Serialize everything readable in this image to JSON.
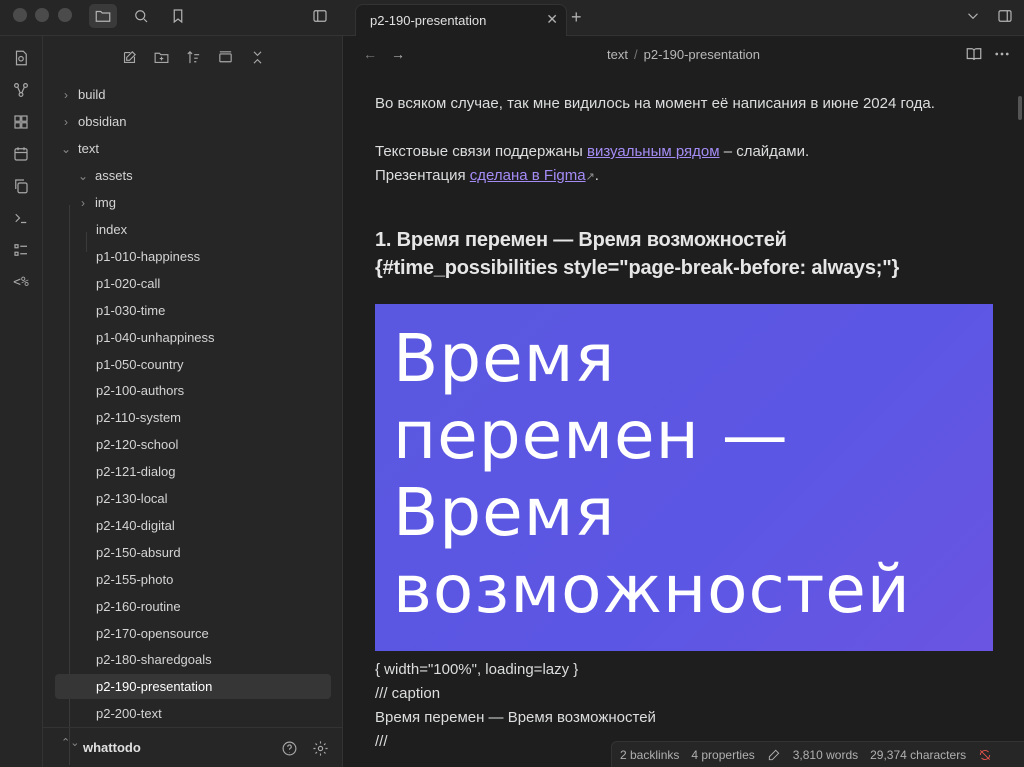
{
  "window": {
    "tab_title": "p2-190-presentation",
    "tab_close": "✕",
    "new_tab": "+"
  },
  "ribbon": {
    "templates_label": "<%"
  },
  "navbar": {
    "back": "←",
    "forward": "→",
    "crumb_folder": "text",
    "crumb_sep": "/",
    "crumb_file": "p2-190-presentation"
  },
  "file_tree": {
    "items": [
      {
        "label": "build",
        "chev": "›"
      },
      {
        "label": "obsidian",
        "chev": "›"
      },
      {
        "label": "text",
        "chev": "⌄"
      },
      {
        "label": "assets",
        "chev": "⌄"
      },
      {
        "label": "img",
        "chev": "›"
      },
      {
        "label": "index"
      },
      {
        "label": "p1-010-happiness"
      },
      {
        "label": "p1-020-call"
      },
      {
        "label": "p1-030-time"
      },
      {
        "label": "p1-040-unhappiness"
      },
      {
        "label": "p1-050-country"
      },
      {
        "label": "p2-100-authors"
      },
      {
        "label": "p2-110-system"
      },
      {
        "label": "p2-120-school"
      },
      {
        "label": "p2-121-dialog"
      },
      {
        "label": "p2-130-local"
      },
      {
        "label": "p2-140-digital"
      },
      {
        "label": "p2-150-absurd"
      },
      {
        "label": "p2-155-photo"
      },
      {
        "label": "p2-160-routine"
      },
      {
        "label": "p2-170-opensource"
      },
      {
        "label": "p2-180-sharedgoals"
      },
      {
        "label": "p2-190-presentation"
      },
      {
        "label": "p2-200-text"
      }
    ]
  },
  "sidebar_footer": {
    "vault_name": "whattodo",
    "switch_icon": "⌃⌄"
  },
  "document": {
    "line1": "Во всяком случае, так мне видилось на момент её написания в июне 2024 года.",
    "line2_before": "Текстовые связи поддержаны ",
    "line2_link": "визуальным рядом",
    "line2_after": " – слайдами.",
    "line3_before": "Презентация ",
    "line3_link": "сделана в Figma",
    "line3_ext": "↗",
    "line3_after": ".",
    "heading_line1": "1. Время перемен — Время возможностей",
    "heading_line2": "{#time_possibilities style=\"page-break-before: always;\"}",
    "slide_line1": "Время",
    "slide_line2": "перемен —",
    "slide_line3": "Время",
    "slide_line4": "возможностей",
    "attr_line": "{ width=\"100%\", loading=lazy }",
    "caption_open": "/// caption",
    "caption_text": "Время перемен — Время возможностей",
    "caption_close": "///"
  },
  "status_bar": {
    "backlinks": "2 backlinks",
    "properties": "4 properties",
    "words": "3,810 words",
    "characters": "29,374 characters"
  }
}
